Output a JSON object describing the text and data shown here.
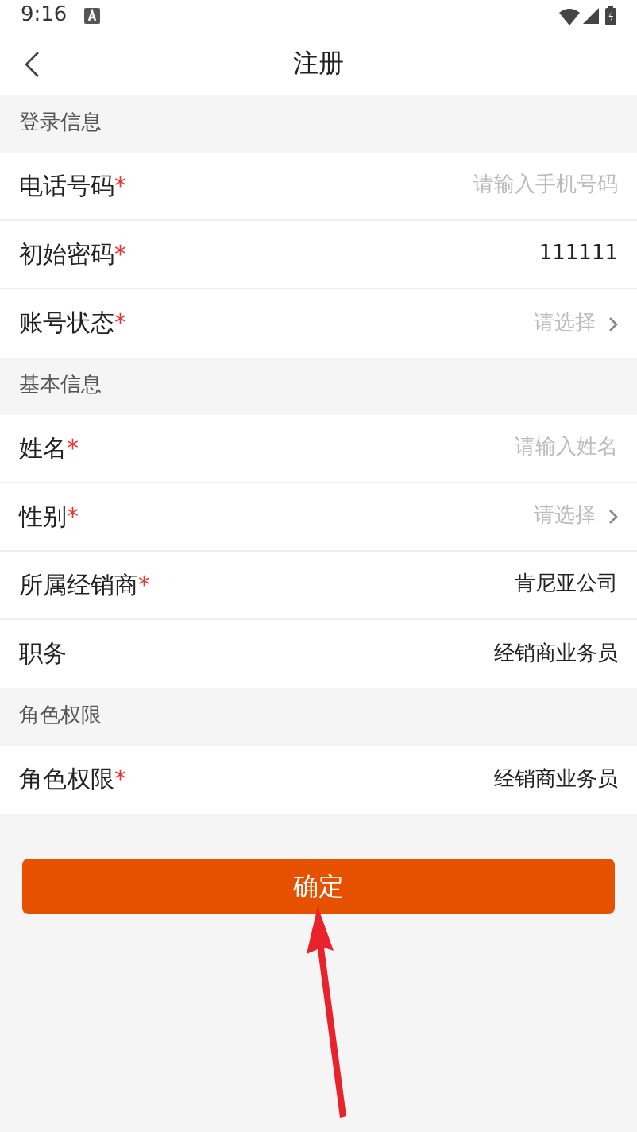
{
  "status_bar": {
    "time": "9:16"
  },
  "header": {
    "title": "注册"
  },
  "sections": [
    {
      "title": "登录信息",
      "rows": [
        {
          "label": "电话号码",
          "mark": "*",
          "kind": "input",
          "placeholder": "请输入手机号码"
        },
        {
          "label": "初始密码",
          "mark": "*",
          "kind": "text",
          "value": "111111"
        },
        {
          "label": "账号状态",
          "mark": "*",
          "kind": "select",
          "placeholder": "请选择"
        }
      ]
    },
    {
      "title": "基本信息",
      "rows": [
        {
          "label": "姓名",
          "mark": "*",
          "kind": "input",
          "placeholder": "请输入姓名"
        },
        {
          "label": "性别",
          "mark": "*",
          "kind": "select",
          "placeholder": "请选择"
        },
        {
          "label": "所属经销商",
          "mark": "*",
          "kind": "text",
          "value": "肯尼亚公司"
        },
        {
          "label": "职务",
          "kind": "text",
          "value": "经销商业务员"
        }
      ]
    },
    {
      "title": "角色权限",
      "rows": [
        {
          "label": "角色权限",
          "mark": "*",
          "kind": "text",
          "value": "经销商业务员"
        }
      ]
    }
  ],
  "confirm_button": {
    "label": "确定"
  }
}
